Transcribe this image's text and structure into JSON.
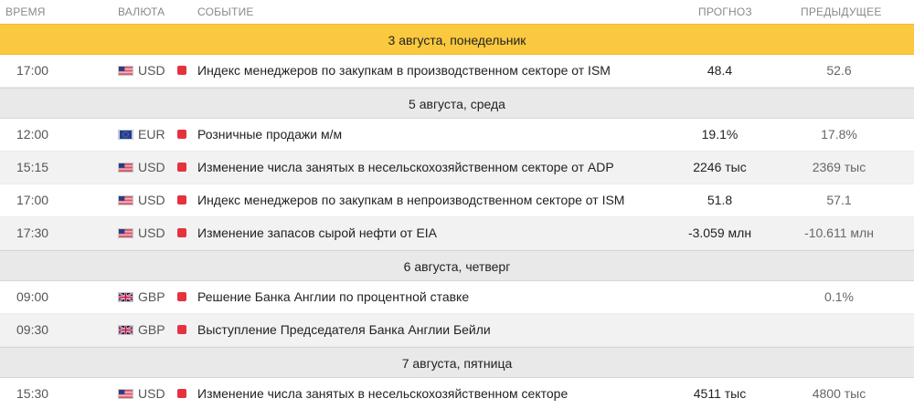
{
  "columns": {
    "time": "ВРЕМЯ",
    "currency": "ВАЛЮТА",
    "event": "СОБЫТИЕ",
    "forecast": "ПРОГНОЗ",
    "previous": "ПРЕДЫДУЩЕЕ"
  },
  "days": [
    {
      "label": "3 августа, понедельник",
      "highlighted": true,
      "events": [
        {
          "time": "17:00",
          "flag": "us-flag-icon",
          "currency": "USD",
          "event": "Индекс менеджеров по закупкам в производственном секторе от ISM",
          "forecast": "48.4",
          "previous": "52.6"
        }
      ]
    },
    {
      "label": "5 августа, среда",
      "highlighted": false,
      "events": [
        {
          "time": "12:00",
          "flag": "eu-flag-icon",
          "currency": "EUR",
          "event": "Розничные продажи м/м",
          "forecast": "19.1%",
          "previous": "17.8%"
        },
        {
          "time": "15:15",
          "flag": "us-flag-icon",
          "currency": "USD",
          "event": "Изменение числа занятых в несельскохозяйственном секторе от ADP",
          "forecast": "2246 тыс",
          "previous": "2369 тыс"
        },
        {
          "time": "17:00",
          "flag": "us-flag-icon",
          "currency": "USD",
          "event": "Индекс менеджеров по закупкам в непроизводственном секторе от ISM",
          "forecast": "51.8",
          "previous": "57.1"
        },
        {
          "time": "17:30",
          "flag": "us-flag-icon",
          "currency": "USD",
          "event": "Изменение запасов сырой нефти от EIA",
          "forecast": "-3.059 млн",
          "previous": "-10.611 млн"
        }
      ]
    },
    {
      "label": "6 августа, четверг",
      "highlighted": false,
      "events": [
        {
          "time": "09:00",
          "flag": "gb-flag-icon",
          "currency": "GBP",
          "event": "Решение Банка Англии по процентной ставке",
          "forecast": "",
          "previous": "0.1%"
        },
        {
          "time": "09:30",
          "flag": "gb-flag-icon",
          "currency": "GBP",
          "event": "Выступление Председателя Банка Англии Бейли",
          "forecast": "",
          "previous": ""
        }
      ]
    },
    {
      "label": "7 августа, пятница",
      "highlighted": false,
      "events": [
        {
          "time": "15:30",
          "flag": "us-flag-icon",
          "currency": "USD",
          "event": "Изменение числа занятых в несельскохозяйственном секторе",
          "forecast": "4511 тыс",
          "previous": "4800 тыс"
        }
      ]
    }
  ],
  "colors": {
    "highlight_day": "#fbc93f",
    "day_band": "#e9e9e9",
    "impact_high": "#e53240"
  }
}
